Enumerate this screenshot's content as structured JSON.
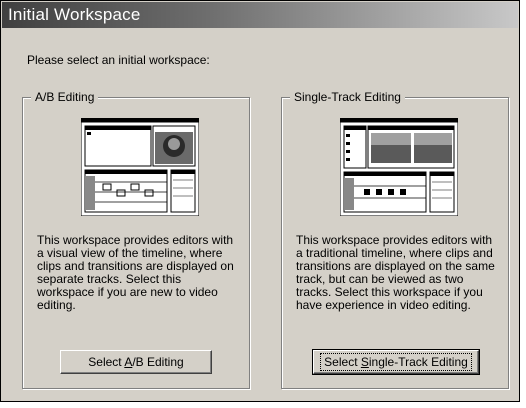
{
  "window": {
    "title": "Initial Workspace"
  },
  "prompt": "Please select an initial workspace:",
  "options": [
    {
      "group_label": "A/B Editing",
      "description": "This workspace provides editors with a visual view of the timeline, where clips and transitions are displayed on separate tracks. Select this workspace if you are new to video editing.",
      "button": {
        "before": "Select ",
        "mnemonic": "A",
        "after": "/B Editing"
      }
    },
    {
      "group_label": "Single-Track Editing",
      "description": "This workspace provides editors with a traditional timeline, where clips and transitions are displayed on the same track, but can be viewed as two tracks. Select this workspace if you have experience in video editing.",
      "button": {
        "before": "Select ",
        "mnemonic": "S",
        "after": "ingle-Track Editing"
      }
    }
  ],
  "colors": {
    "dialog_bg": "#d4d0c8",
    "title_text": "#ffffff",
    "title_gradient_start": "#404040"
  }
}
